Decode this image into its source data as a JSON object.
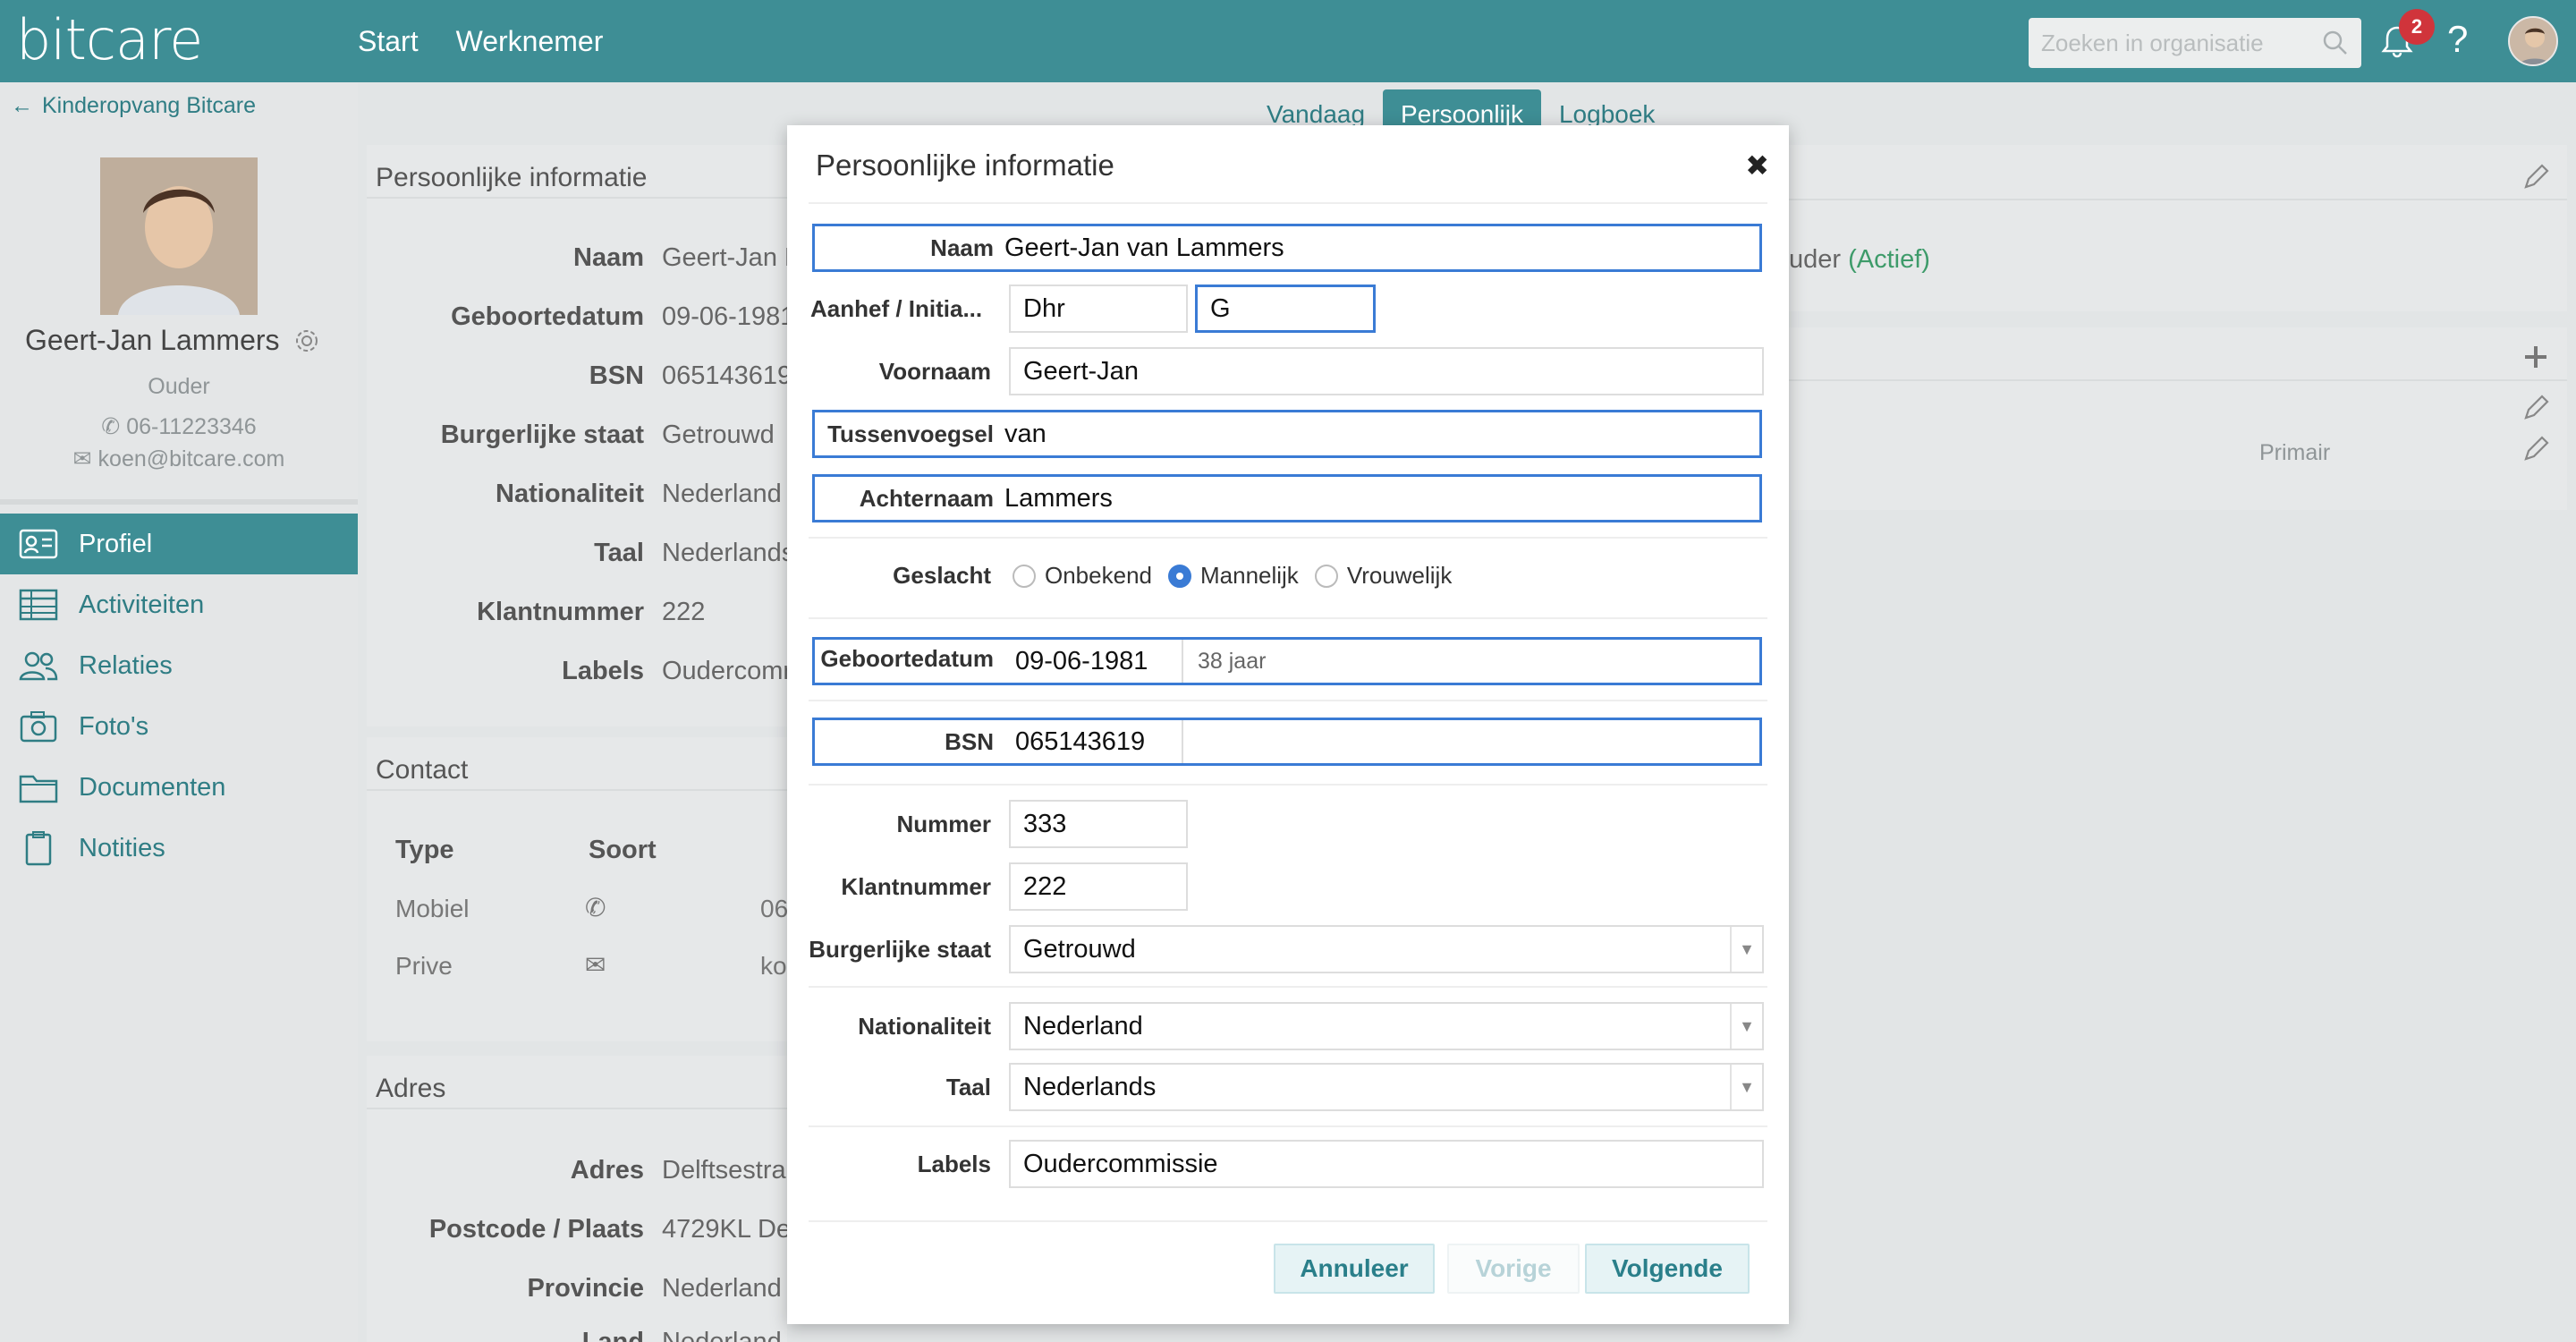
{
  "app": {
    "logo": "bitcare"
  },
  "topnav": [
    "Start",
    "Werknemer"
  ],
  "search": {
    "placeholder": "Zoeken in organisatie"
  },
  "notifications": {
    "count": "2"
  },
  "help": "?",
  "sidebar": {
    "back_label": "Kinderopvang Bitcare",
    "profile": {
      "name": "Geert-Jan Lammers",
      "role": "Ouder",
      "phone": "06-11223346",
      "email": "koen@bitcare.com"
    },
    "menu": [
      {
        "label": "Profiel",
        "icon": "id-card-icon",
        "active": true
      },
      {
        "label": "Activiteiten",
        "icon": "table-icon"
      },
      {
        "label": "Relaties",
        "icon": "users-icon"
      },
      {
        "label": "Foto's",
        "icon": "camera-icon"
      },
      {
        "label": "Documenten",
        "icon": "folder-icon"
      },
      {
        "label": "Notities",
        "icon": "clipboard-icon"
      }
    ]
  },
  "tabs": [
    "Vandaag",
    "Persoonlijk",
    "Logboek"
  ],
  "bg": {
    "personal_title": "Persoonlijke informatie",
    "rows": [
      {
        "label": "Naam",
        "value": "Geert-Jan L"
      },
      {
        "label": "Geboortedatum",
        "value": "09-06-1981"
      },
      {
        "label": "BSN",
        "value": "065143619"
      },
      {
        "label": "Burgerlijke staat",
        "value": "Getrouwd"
      },
      {
        "label": "Nationaliteit",
        "value": "Nederland"
      },
      {
        "label": "Taal",
        "value": "Nederlands"
      },
      {
        "label": "Klantnummer",
        "value": "222"
      },
      {
        "label": "Labels",
        "value": "Oudercomm"
      }
    ],
    "contact_title": "Contact",
    "contact_headers": [
      "Type",
      "Soort"
    ],
    "contact_rows": [
      {
        "type": "Mobiel",
        "icon": "phone-icon",
        "value": "06"
      },
      {
        "type": "Prive",
        "icon": "mail-icon",
        "value": "ko"
      }
    ],
    "address_title": "Adres",
    "address_rows": [
      {
        "label": "Adres",
        "value": "Delftsestra"
      },
      {
        "label": "Postcode / Plaats",
        "value": "4729KL De"
      },
      {
        "label": "Provincie",
        "value": "Nederland"
      },
      {
        "label": "Land",
        "value": "Nederland"
      }
    ],
    "right_role": "uder",
    "right_status": "(Actief)",
    "right_primary": "Primair"
  },
  "modal": {
    "title": "Persoonlijke informatie",
    "close": "✖",
    "fields": {
      "naam": {
        "label": "Naam",
        "value": "Geert-Jan van Lammers"
      },
      "aanhef": {
        "label": "Aanhef / Initia...",
        "value": "Dhr",
        "initials": "G"
      },
      "voornaam": {
        "label": "Voornaam",
        "value": "Geert-Jan"
      },
      "tussenvoegsel": {
        "label": "Tussenvoegsel",
        "value": "van"
      },
      "achternaam": {
        "label": "Achternaam",
        "value": "Lammers"
      },
      "geslacht": {
        "label": "Geslacht",
        "options": [
          "Onbekend",
          "Mannelijk",
          "Vrouwelijk"
        ],
        "selected": "Mannelijk"
      },
      "geboortedatum": {
        "label": "Geboortedatum",
        "value": "09-06-1981",
        "age": "38 jaar"
      },
      "bsn": {
        "label": "BSN",
        "value": "065143619"
      },
      "nummer": {
        "label": "Nummer",
        "value": "333"
      },
      "klantnummer": {
        "label": "Klantnummer",
        "value": "222"
      },
      "burgerlijke_staat": {
        "label": "Burgerlijke staat",
        "value": "Getrouwd"
      },
      "nationaliteit": {
        "label": "Nationaliteit",
        "value": "Nederland"
      },
      "taal": {
        "label": "Taal",
        "value": "Nederlands"
      },
      "labels": {
        "label": "Labels",
        "value": "Oudercommissie"
      }
    },
    "buttons": {
      "cancel": "Annuleer",
      "prev": "Vorige",
      "next": "Volgende"
    }
  },
  "colors": {
    "brand": "#3e8e95",
    "focus": "#3a7bd5",
    "badge": "#d0343b"
  }
}
